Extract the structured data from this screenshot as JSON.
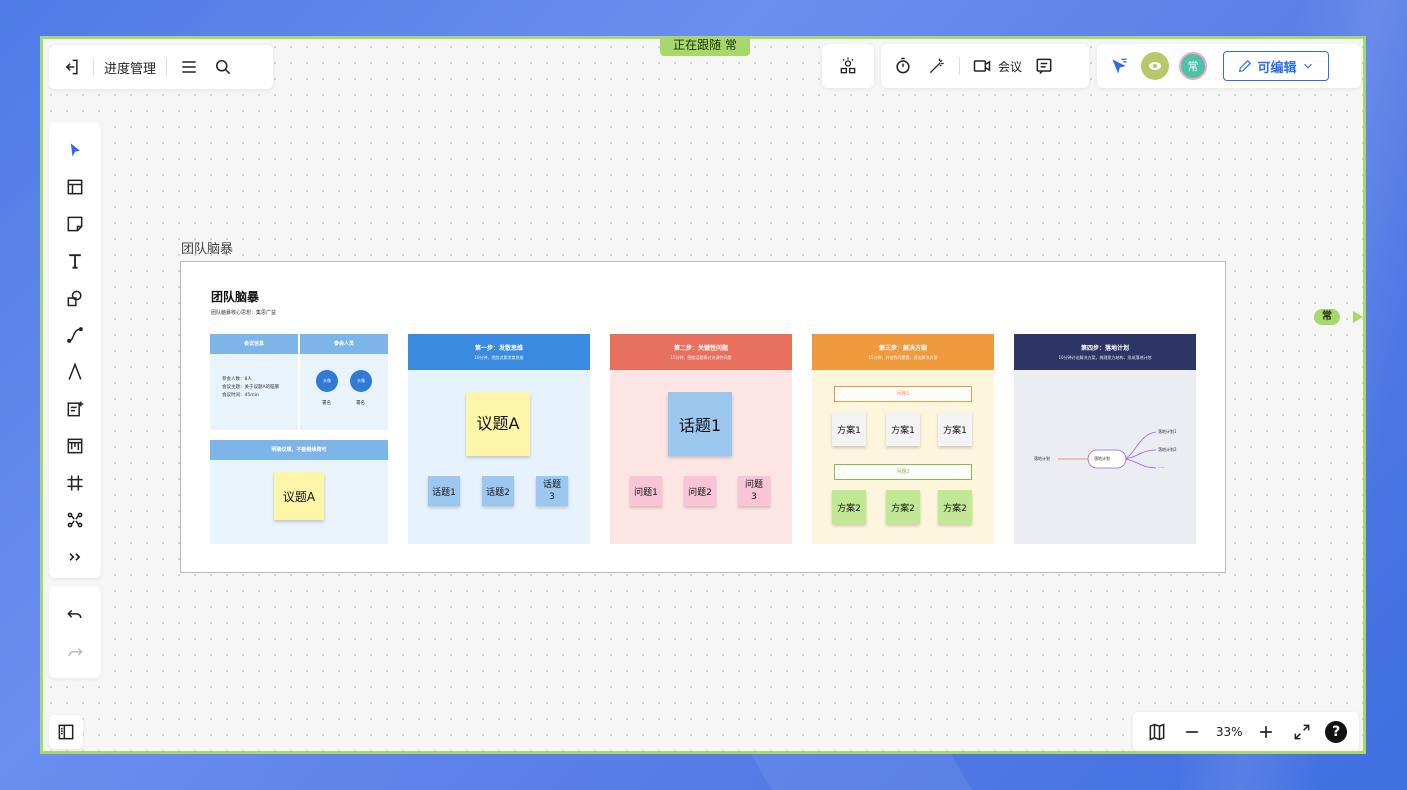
{
  "app": {
    "follow_label": "正在跟随 常",
    "doc_title": "进度管理",
    "meeting_label": "会议",
    "edit_label": "可编辑",
    "avatar_name": "常",
    "side_user_tag": "常",
    "zoom": "33%"
  },
  "board": {
    "label": "团队脑暴",
    "title": "团队脑暴",
    "subtitle": "团队脑暴核心思想：集思广益",
    "info": {
      "meeting_info": "会议信息",
      "participants": "参会人员",
      "lines": [
        "参会人数：8人",
        "会议主题：关于议题A的脑暴",
        "会议时间：45min"
      ],
      "avatar_text": "头像",
      "sign": "署名",
      "bottom_head": "明确议题，不能继续跨可",
      "topic": "议题A"
    },
    "step1": {
      "title": "第一步：发散思维",
      "sub": "10分钟，围绕议题发散思维",
      "main": "议题A",
      "items": [
        "话题1",
        "话题2",
        "话题3"
      ]
    },
    "step2": {
      "title": "第二步：关键性问题",
      "sub": "15分钟，围绕话题探讨关键性问题",
      "main": "话题1",
      "items": [
        "问题1",
        "问题2",
        "问题3"
      ]
    },
    "step3": {
      "title": "第三步：解决方案",
      "sub": "15分钟，共创性问题题，提出解决方案",
      "q1": "问题1",
      "q2": "问题2",
      "row1": [
        "方案1",
        "方案1",
        "方案1"
      ],
      "row2": [
        "方案2",
        "方案2",
        "方案2"
      ]
    },
    "step4": {
      "title": "第四步：落地计划",
      "sub": "10分钟讨论解决方案，梳理思方结构，形成落地计划",
      "left": "落地计划",
      "center": "落地计划",
      "branches": [
        "落地计划1",
        "落地计划2",
        "....."
      ]
    }
  },
  "colors": {
    "accent": "#2f6ee6",
    "frame_green": "#a6d96a",
    "step1": "#3a8ae0",
    "step2": "#e8705e",
    "step3": "#ef9a3c",
    "step4": "#2d3566",
    "sticky_yellow": "#fdf5a8",
    "sticky_blue": "#9cc8ef",
    "sticky_pink": "#f8c4d6",
    "sticky_green": "#c1e894"
  }
}
